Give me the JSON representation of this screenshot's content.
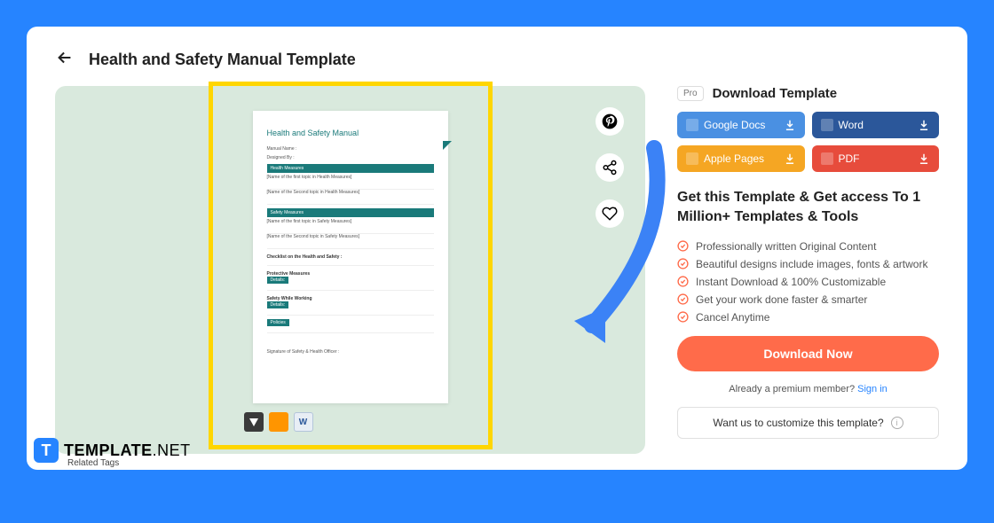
{
  "header": {
    "title": "Health and Safety Manual Template"
  },
  "doc": {
    "title": "Health and Safety Manual",
    "field1": "Manual Name :",
    "field2": "Designed By :",
    "bar1": "Health Measures",
    "sub1": "[Name of the first topic in Health Measures]",
    "sub2": "[Name of the Second topic in Health Measures]",
    "bar2": "Safety Measures",
    "sub3": "[Name of the first topic in Safety Measures]",
    "sub4": "[Name of the Second topic in Safety Measures]",
    "section1": "Checklist on the Health and Safety :",
    "section2": "Protective Measures",
    "btn1": "Details:",
    "section3": "Safety While Working",
    "btn2": "Details:",
    "btn3": "Policies",
    "signature": "Signature of Safety & Health Officer :"
  },
  "sidebar": {
    "pro_label": "Pro",
    "dl_title": "Download Template",
    "formats": [
      {
        "label": "Google Docs",
        "class": "fmt-gdocs"
      },
      {
        "label": "Word",
        "class": "fmt-word2"
      },
      {
        "label": "Apple Pages",
        "class": "fmt-pages2"
      },
      {
        "label": "PDF",
        "class": "fmt-pdf2"
      }
    ],
    "cta_title": "Get this Template & Get access To 1 Million+ Templates & Tools",
    "features": [
      "Professionally written Original Content",
      "Beautiful designs include images, fonts & artwork",
      "Instant Download & 100% Customizable",
      "Get your work done faster & smarter",
      "Cancel Anytime"
    ],
    "download_now": "Download Now",
    "signin_prefix": "Already a premium member? ",
    "signin_link": "Sign in",
    "customize": "Want us to customize this template?"
  },
  "footer": {
    "logo_bold": "TEMPLATE",
    "logo_net": ".NET",
    "related": "Related Tags"
  }
}
